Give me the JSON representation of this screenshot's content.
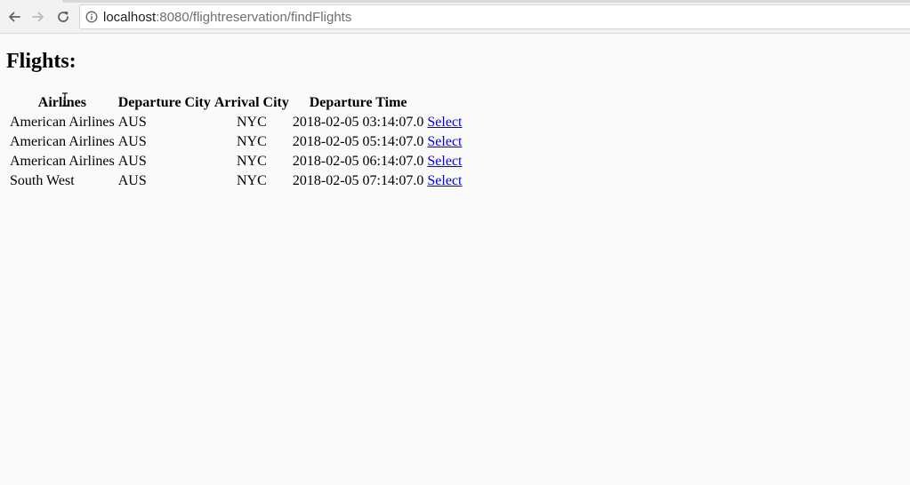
{
  "browser": {
    "url_host": "localhost",
    "url_path": ":8080/flightreservation/findFlights"
  },
  "page": {
    "title": "Flights:"
  },
  "table": {
    "headers": [
      "Airlines",
      "Departure City",
      "Arrival City",
      "Departure Time",
      ""
    ],
    "rows": [
      {
        "airline": "American Airlines",
        "departure_city": "AUS",
        "arrival_city": "NYC",
        "departure_time": "2018-02-05 03:14:07.0",
        "action": "Select"
      },
      {
        "airline": "American Airlines",
        "departure_city": "AUS",
        "arrival_city": "NYC",
        "departure_time": "2018-02-05 05:14:07.0",
        "action": "Select"
      },
      {
        "airline": "American Airlines",
        "departure_city": "AUS",
        "arrival_city": "NYC",
        "departure_time": "2018-02-05 06:14:07.0",
        "action": "Select"
      },
      {
        "airline": "South West",
        "departure_city": "AUS",
        "arrival_city": "NYC",
        "departure_time": "2018-02-05 07:14:07.0",
        "action": "Select"
      }
    ]
  },
  "colors": {
    "link": "#0000ee",
    "page_background": "#fafafa",
    "toolbar_background": "#f2f2f2"
  },
  "icons": {
    "back": "arrow-left-icon",
    "forward": "arrow-right-icon",
    "reload": "reload-icon",
    "site_info": "info-circle-icon",
    "cursor": "text-cursor-icon"
  }
}
